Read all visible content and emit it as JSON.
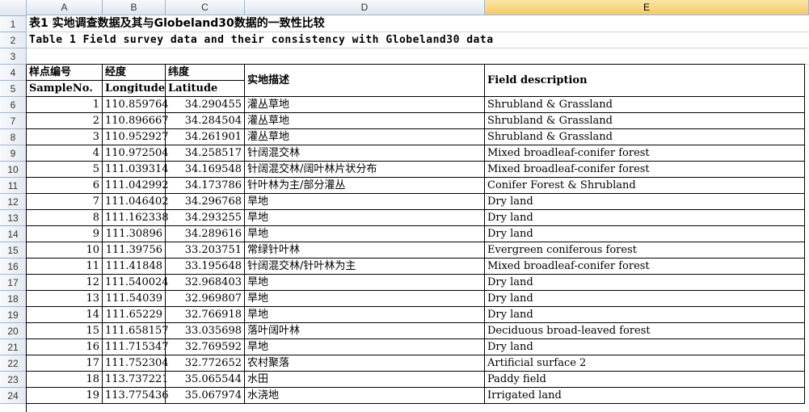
{
  "columns": [
    "A",
    "B",
    "C",
    "D",
    "E"
  ],
  "selected_column": "E",
  "rows": [
    "1",
    "2",
    "3",
    "4",
    "5",
    "6",
    "7",
    "8",
    "9",
    "10",
    "11",
    "12",
    "13",
    "14",
    "15",
    "16",
    "17",
    "18",
    "19",
    "20",
    "21",
    "22",
    "23",
    "24"
  ],
  "title_cn": "表1 实地调查数据及其与Globeland30数据的一致性比较",
  "title_en": "Table 1 Field survey data and their consistency with Globeland30 data",
  "header_cn": {
    "sample": "样点编号",
    "lon": "经度",
    "lat": "纬度",
    "desc": "实地描述"
  },
  "header_en": {
    "sample": "SampleNo.",
    "lon": "Longitude",
    "lat": "Latitude",
    "desc": "Field description"
  },
  "records": [
    {
      "no": "1",
      "lon": "110.859764",
      "lat": "34.290455",
      "cn": "灌丛草地",
      "en": "Shrubland & Grassland"
    },
    {
      "no": "2",
      "lon": "110.896667",
      "lat": "34.284504",
      "cn": "灌丛草地",
      "en": "Shrubland & Grassland"
    },
    {
      "no": "3",
      "lon": "110.952927",
      "lat": "34.261901",
      "cn": "灌丛草地",
      "en": "Shrubland & Grassland"
    },
    {
      "no": "4",
      "lon": "110.972504",
      "lat": "34.258517",
      "cn": "针阔混交林",
      "en": "Mixed broadleaf-conifer forest"
    },
    {
      "no": "5",
      "lon": "111.039314",
      "lat": "34.169548",
      "cn": "针阔混交林/阔叶林片状分布",
      "en": "Mixed broadleaf-conifer forest"
    },
    {
      "no": "6",
      "lon": "111.042992",
      "lat": "34.173786",
      "cn": "针叶林为主/部分灌丛",
      "en": "Conifer Forest & Shrubland"
    },
    {
      "no": "7",
      "lon": "111.046402",
      "lat": "34.296768",
      "cn": "旱地",
      "en": "Dry land"
    },
    {
      "no": "8",
      "lon": "111.162338",
      "lat": "34.293255",
      "cn": "旱地",
      "en": "Dry land"
    },
    {
      "no": "9",
      "lon": "111.30896",
      "lat": "34.289616",
      "cn": "旱地",
      "en": "Dry land"
    },
    {
      "no": "10",
      "lon": "111.39756",
      "lat": "33.203751",
      "cn": "常绿针叶林",
      "en": "Evergreen coniferous forest"
    },
    {
      "no": "11",
      "lon": "111.41848",
      "lat": "33.195648",
      "cn": "针阔混交林/针叶林为主",
      "en": "Mixed broadleaf-conifer forest"
    },
    {
      "no": "12",
      "lon": "111.540024",
      "lat": "32.968403",
      "cn": "旱地",
      "en": "Dry land"
    },
    {
      "no": "13",
      "lon": "111.54039",
      "lat": "32.969807",
      "cn": "旱地",
      "en": "Dry land"
    },
    {
      "no": "14",
      "lon": "111.65229",
      "lat": "32.766918",
      "cn": "旱地",
      "en": "Dry land"
    },
    {
      "no": "15",
      "lon": "111.658157",
      "lat": "33.035698",
      "cn": "落叶阔叶林",
      "en": "Deciduous broad-leaved forest"
    },
    {
      "no": "16",
      "lon": "111.715347",
      "lat": "32.769592",
      "cn": "旱地",
      "en": "Dry land"
    },
    {
      "no": "17",
      "lon": "111.752304",
      "lat": "32.772652",
      "cn": "农村聚落",
      "en": "Artificial surface 2"
    },
    {
      "no": "18",
      "lon": "113.737221",
      "lat": "35.065544",
      "cn": "水田",
      "en": "Paddy field"
    },
    {
      "no": "19",
      "lon": "113.775436",
      "lat": "35.067974",
      "cn": "水浇地",
      "en": "Irrigated land"
    }
  ]
}
